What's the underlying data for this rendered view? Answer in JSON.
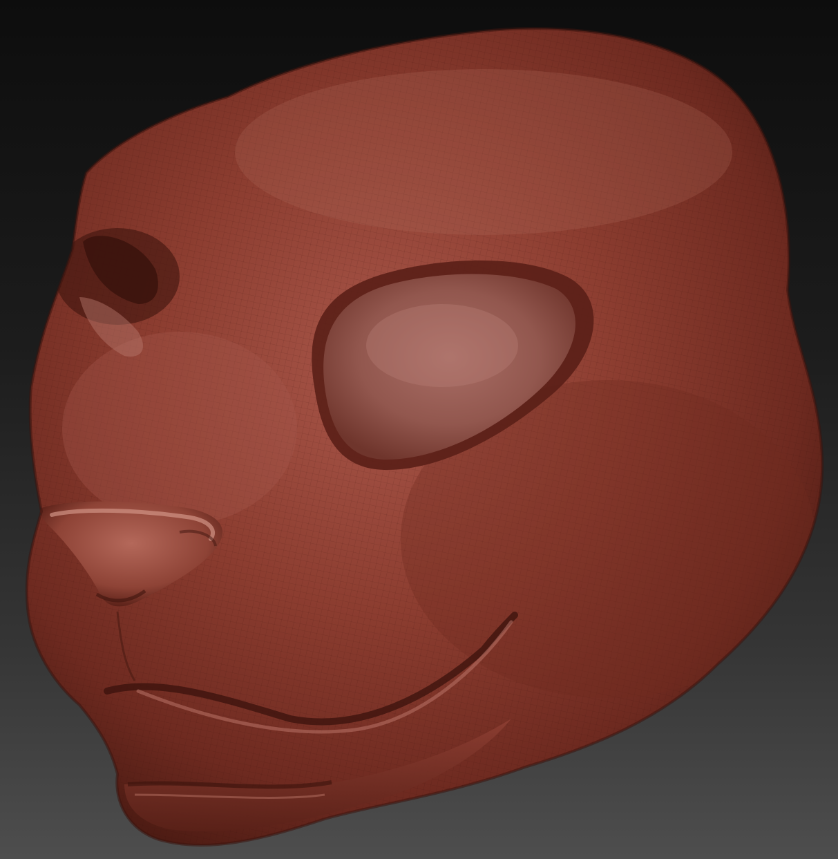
{
  "viewport": {
    "background_top": "#0d0d0d",
    "background_bottom": "#4e4e4e"
  },
  "model": {
    "subject": "sculpted-animal-head",
    "material_color": "#8a3b2e",
    "highlight_color": "#c98577",
    "shadow_color": "#4a1a12",
    "wireframe_visible": true
  }
}
